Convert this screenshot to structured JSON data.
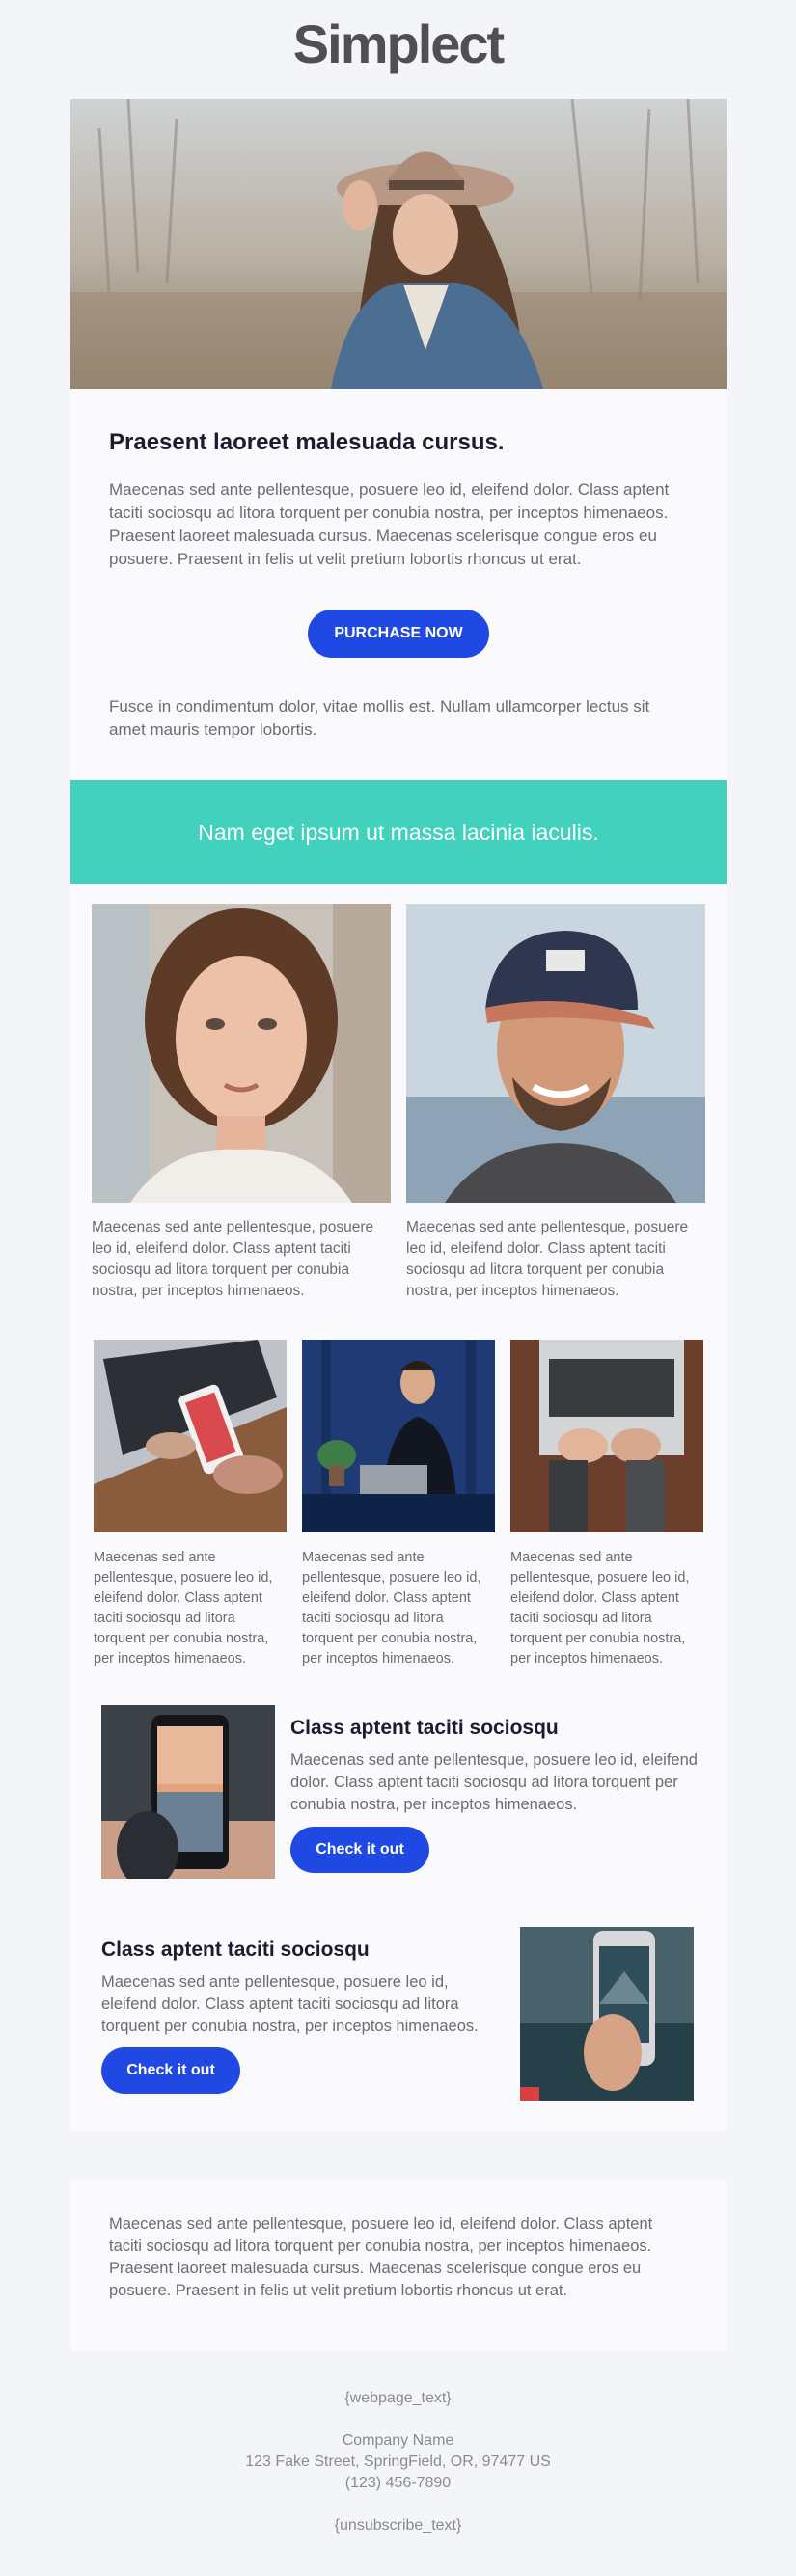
{
  "logo": "Simplect",
  "intro": {
    "headline": "Praesent laoreet malesuada cursus.",
    "paragraph": "Maecenas sed ante pellentesque, posuere leo id, eleifend dolor. Class aptent taciti sociosqu ad litora torquent per conubia nostra, per inceptos himenaeos. Praesent laoreet malesuada cursus. Maecenas scelerisque congue eros eu posuere. Praesent in felis ut velit pretium lobortis rhoncus ut erat.",
    "button_label": "PURCHASE NOW",
    "closing": "Fusce in condimentum dolor, vitae mollis est. Nullam ullamcorper lectus sit amet mauris tempor lobortis."
  },
  "banner": {
    "text": "Nam eget ipsum ut massa lacinia iaculis.",
    "color": "#41d1bd"
  },
  "two_col": [
    {
      "caption": "Maecenas sed ante pellentesque, posuere leo id, eleifend dolor. Class aptent taciti sociosqu ad litora torquent per conubia nostra, per inceptos himenaeos."
    },
    {
      "caption": "Maecenas sed ante pellentesque, posuere leo id, eleifend dolor. Class aptent taciti sociosqu ad litora torquent per conubia nostra, per inceptos himenaeos."
    }
  ],
  "three_col": [
    {
      "caption": "Maecenas sed ante pellentesque, posuere leo id, eleifend dolor. Class aptent taciti sociosqu ad litora torquent per conubia nostra, per inceptos himenaeos."
    },
    {
      "caption": "Maecenas sed ante pellentesque, posuere leo id, eleifend dolor. Class aptent taciti sociosqu ad litora torquent per conubia nostra, per inceptos himenaeos."
    },
    {
      "caption": "Maecenas sed ante pellentesque, posuere leo id, eleifend dolor. Class aptent taciti sociosqu ad litora torquent per conubia nostra, per inceptos himenaeos."
    }
  ],
  "features": [
    {
      "title": "Class aptent taciti sociosqu",
      "text": "Maecenas sed ante pellentesque, posuere leo id, eleifend dolor. Class aptent taciti sociosqu ad litora torquent per conubia nostra, per inceptos himenaeos.",
      "button_label": "Check it out"
    },
    {
      "title": "Class aptent taciti sociosqu",
      "text": "Maecenas sed ante pellentesque, posuere leo id, eleifend dolor. Class aptent taciti sociosqu ad litora torquent per conubia nostra, per inceptos himenaeos.",
      "button_label": "Check it out"
    }
  ],
  "outro": "Maecenas sed ante pellentesque, posuere leo id, eleifend dolor. Class aptent taciti sociosqu ad litora torquent per conubia nostra, per inceptos himenaeos. Praesent laoreet malesuada cursus. Maecenas scelerisque congue eros eu posuere. Praesent in felis ut velit pretium lobortis rhoncus ut erat.",
  "footer": {
    "webpage_link": "{webpage_text}",
    "company": "Company Name",
    "address": "123 Fake Street, SpringField, OR, 97477 US",
    "phone": "(123) 456-7890",
    "unsubscribe_link": "{unsubscribe_text}"
  },
  "colors": {
    "accent_button": "#2049e3",
    "banner": "#41d1bd"
  }
}
